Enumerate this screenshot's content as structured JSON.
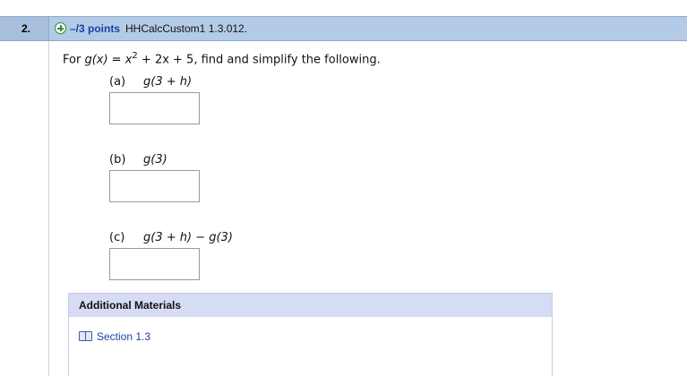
{
  "question": {
    "number": "2.",
    "points": "–/3 points",
    "id": "HHCalcCustom1 1.3.012."
  },
  "statement": {
    "prefix": "For",
    "function": "g(x) = x",
    "exponent": "2",
    "rest": " + 2x + 5,  find and simplify the following."
  },
  "parts": [
    {
      "label": "(a)",
      "expression": "g(3 + h)",
      "answer": ""
    },
    {
      "label": "(b)",
      "expression": "g(3)",
      "answer": ""
    },
    {
      "label": "(c)",
      "expression": "g(3 + h) − g(3)",
      "answer": ""
    }
  ],
  "additional_materials": {
    "title": "Additional Materials",
    "link_label": "Section 1.3"
  },
  "colors": {
    "header_bg": "#b3cbe6",
    "points_text": "#1a3fa8",
    "materials_header_bg": "#d6dcf3"
  }
}
